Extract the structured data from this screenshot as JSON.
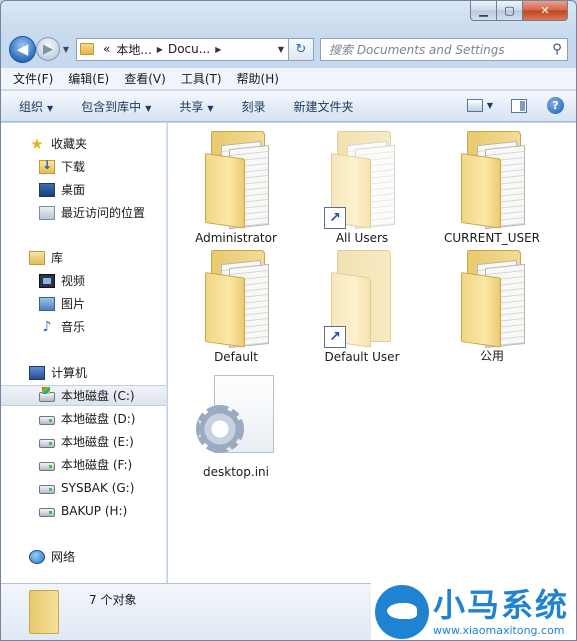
{
  "address": {
    "back_glyph": "◀",
    "forward_glyph": "▶",
    "segments": [
      "«",
      "本地...",
      "Docu..."
    ],
    "refresh_glyph": "↻"
  },
  "search": {
    "placeholder": "搜索 Documents and Settings"
  },
  "menu": [
    "文件(F)",
    "编辑(E)",
    "查看(V)",
    "工具(T)",
    "帮助(H)"
  ],
  "commands": [
    {
      "label": "组织",
      "has_dropdown": true
    },
    {
      "label": "包含到库中",
      "has_dropdown": true
    },
    {
      "label": "共享",
      "has_dropdown": true
    },
    {
      "label": "刻录",
      "has_dropdown": false
    },
    {
      "label": "新建文件夹",
      "has_dropdown": false
    }
  ],
  "nav": {
    "favorites": {
      "label": "收藏夹",
      "icon": "star-icon",
      "items": [
        {
          "label": "下载",
          "icon": "downloads-folder-icon"
        },
        {
          "label": "桌面",
          "icon": "desktop-icon"
        },
        {
          "label": "最近访问的位置",
          "icon": "recent-places-icon"
        }
      ]
    },
    "libraries": {
      "label": "库",
      "icon": "libraries-icon",
      "items": [
        {
          "label": "视频",
          "icon": "videos-icon"
        },
        {
          "label": "图片",
          "icon": "pictures-icon"
        },
        {
          "label": "音乐",
          "icon": "music-icon"
        }
      ]
    },
    "computer": {
      "label": "计算机",
      "icon": "computer-icon",
      "items": [
        {
          "label": "本地磁盘 (C:)",
          "icon": "system-drive-icon",
          "selected": true
        },
        {
          "label": "本地磁盘 (D:)",
          "icon": "drive-icon"
        },
        {
          "label": "本地磁盘 (E:)",
          "icon": "drive-icon"
        },
        {
          "label": "本地磁盘 (F:)",
          "icon": "drive-icon"
        },
        {
          "label": "SYSBAK (G:)",
          "icon": "drive-icon"
        },
        {
          "label": "BAKUP (H:)",
          "icon": "drive-icon"
        }
      ]
    },
    "network": {
      "label": "网络",
      "icon": "network-icon"
    }
  },
  "files": [
    {
      "name": "Administrator",
      "type": "folder",
      "shortcut": false
    },
    {
      "name": "All Users",
      "type": "folder",
      "shortcut": true
    },
    {
      "name": "CURRENT_USER",
      "type": "folder",
      "shortcut": false
    },
    {
      "name": "Default",
      "type": "folder",
      "shortcut": false
    },
    {
      "name": "Default User",
      "type": "folder",
      "shortcut": true
    },
    {
      "name": "公用",
      "type": "folder",
      "shortcut": false
    },
    {
      "name": "desktop.ini",
      "type": "settings-file",
      "shortcut": false
    }
  ],
  "details": {
    "count_text": "7 个对象"
  },
  "watermark": {
    "brand": "小马系统",
    "url": "www.xiaomaxitong.com"
  },
  "colors": {
    "accent": "#1f83d1",
    "selection": "#dde4ee",
    "folder": "#f2d685"
  }
}
